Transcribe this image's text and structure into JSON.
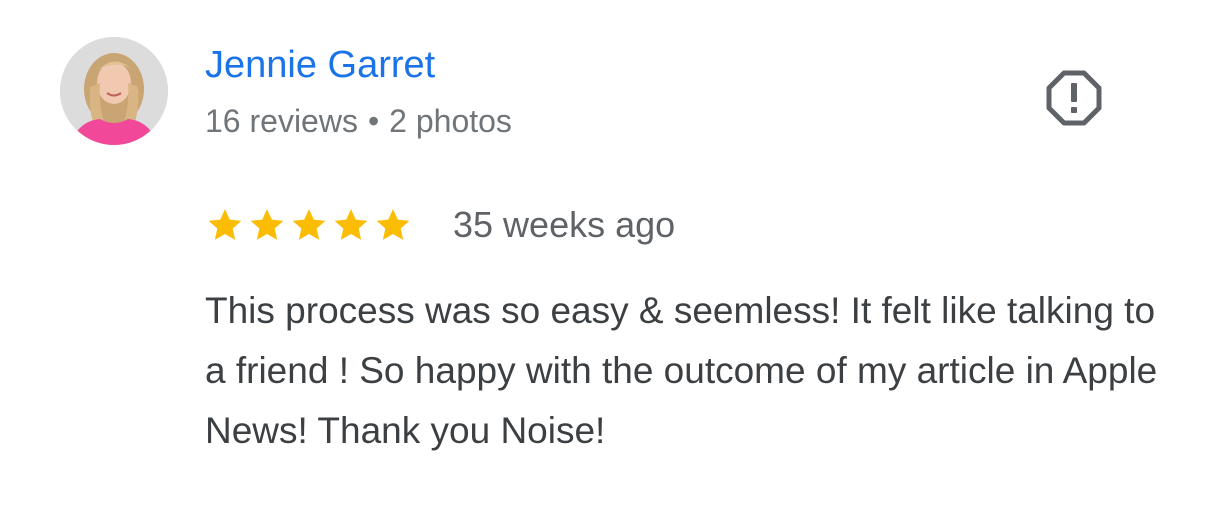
{
  "review": {
    "author": {
      "name": "Jennie Garret",
      "reviews_count": "16 reviews",
      "separator": "•",
      "photos_count": "2 photos",
      "avatar_icon": "profile-photo"
    },
    "rating": {
      "value": 5,
      "max": 5,
      "star_icon": "star-icon",
      "star_color": "#fbbc04"
    },
    "date": "35 weeks ago",
    "text": "This process was so easy & seemless! It felt like talking to a friend ! So happy with the outcome of my article in Apple News! Thank you Noise!",
    "report_icon": "report-octagon-icon"
  },
  "colors": {
    "name": "#1a73e8",
    "meta": "#70757a",
    "body_text": "#3c4043",
    "icon": "#5f6368"
  }
}
